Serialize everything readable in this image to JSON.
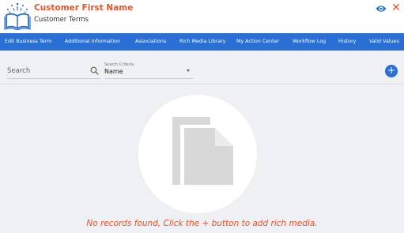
{
  "header": {
    "title": "Customer First Name",
    "subtitle": "Customer Terms"
  },
  "nav": {
    "items": [
      "Edit Business Term",
      "Additional Information",
      "Associations",
      "Rich Media Library",
      "My Action Center",
      "Workflow Log",
      "History",
      "Valid Values"
    ]
  },
  "search": {
    "placeholder": "Search"
  },
  "criteria": {
    "label": "Search Criteria",
    "value": "Name"
  },
  "add_button": {
    "label": "+"
  },
  "empty_state": {
    "message": "No records found, Click the + button to add rich media."
  },
  "colors": {
    "accent": "#e8542a",
    "nav_bg": "#2a6fd4",
    "background": "#eef0f3"
  }
}
